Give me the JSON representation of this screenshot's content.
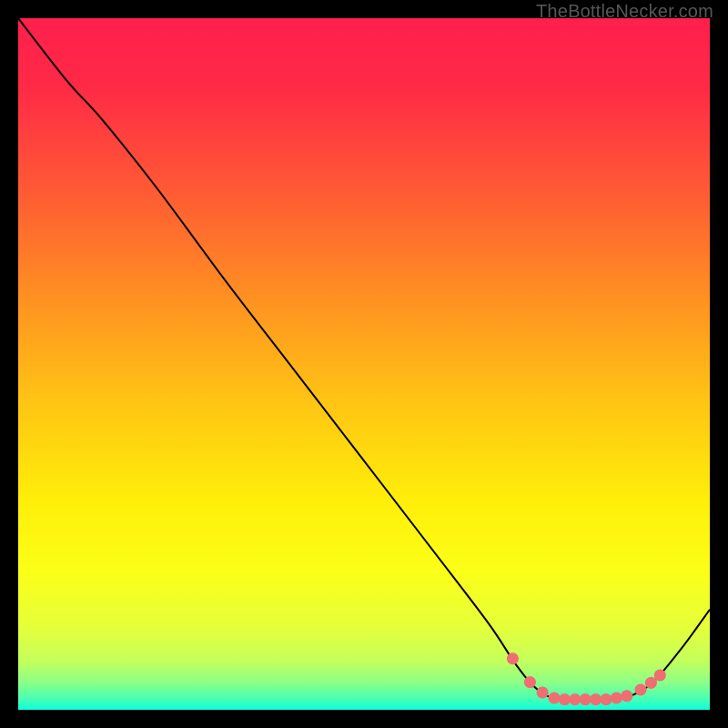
{
  "attribution": "TheBottleNecker.com",
  "chart_data": {
    "type": "line",
    "title": "",
    "xlabel": "",
    "ylabel": "",
    "xlim": [
      0,
      100
    ],
    "ylim": [
      0,
      100
    ],
    "gradient_stops": [
      {
        "offset": 0.0,
        "color": "#ff1f4c"
      },
      {
        "offset": 0.1,
        "color": "#ff2a46"
      },
      {
        "offset": 0.25,
        "color": "#ff5a34"
      },
      {
        "offset": 0.4,
        "color": "#ff8f22"
      },
      {
        "offset": 0.55,
        "color": "#ffc314"
      },
      {
        "offset": 0.7,
        "color": "#ffef09"
      },
      {
        "offset": 0.8,
        "color": "#fcff18"
      },
      {
        "offset": 0.88,
        "color": "#e6ff3a"
      },
      {
        "offset": 0.93,
        "color": "#c3ff5c"
      },
      {
        "offset": 0.96,
        "color": "#8dff87"
      },
      {
        "offset": 0.985,
        "color": "#46ffb6"
      },
      {
        "offset": 1.0,
        "color": "#0dffdc"
      }
    ],
    "curve": [
      {
        "x": 0.0,
        "y": 100.0
      },
      {
        "x": 7.0,
        "y": 91.0
      },
      {
        "x": 12.0,
        "y": 85.5
      },
      {
        "x": 20.0,
        "y": 75.5
      },
      {
        "x": 30.0,
        "y": 62.0
      },
      {
        "x": 40.0,
        "y": 49.0
      },
      {
        "x": 50.0,
        "y": 36.0
      },
      {
        "x": 60.0,
        "y": 23.0
      },
      {
        "x": 68.0,
        "y": 12.5
      },
      {
        "x": 72.0,
        "y": 6.5
      },
      {
        "x": 75.0,
        "y": 3.0
      },
      {
        "x": 78.0,
        "y": 1.5
      },
      {
        "x": 82.0,
        "y": 1.3
      },
      {
        "x": 86.0,
        "y": 1.4
      },
      {
        "x": 89.0,
        "y": 2.2
      },
      {
        "x": 92.0,
        "y": 4.2
      },
      {
        "x": 96.0,
        "y": 9.0
      },
      {
        "x": 100.0,
        "y": 14.5
      }
    ],
    "dots": [
      {
        "x": 71.5,
        "y": 7.4
      },
      {
        "x": 74.0,
        "y": 4.0
      },
      {
        "x": 75.8,
        "y": 2.5
      },
      {
        "x": 77.5,
        "y": 1.7
      },
      {
        "x": 79.0,
        "y": 1.5
      },
      {
        "x": 80.5,
        "y": 1.5
      },
      {
        "x": 82.0,
        "y": 1.5
      },
      {
        "x": 83.5,
        "y": 1.5
      },
      {
        "x": 85.0,
        "y": 1.5
      },
      {
        "x": 86.5,
        "y": 1.7
      },
      {
        "x": 88.0,
        "y": 2.0
      },
      {
        "x": 90.0,
        "y": 2.9
      },
      {
        "x": 91.5,
        "y": 3.9
      },
      {
        "x": 92.8,
        "y": 5.0
      }
    ],
    "dot_color": "#ee6e72",
    "curve_color": "#000000"
  }
}
